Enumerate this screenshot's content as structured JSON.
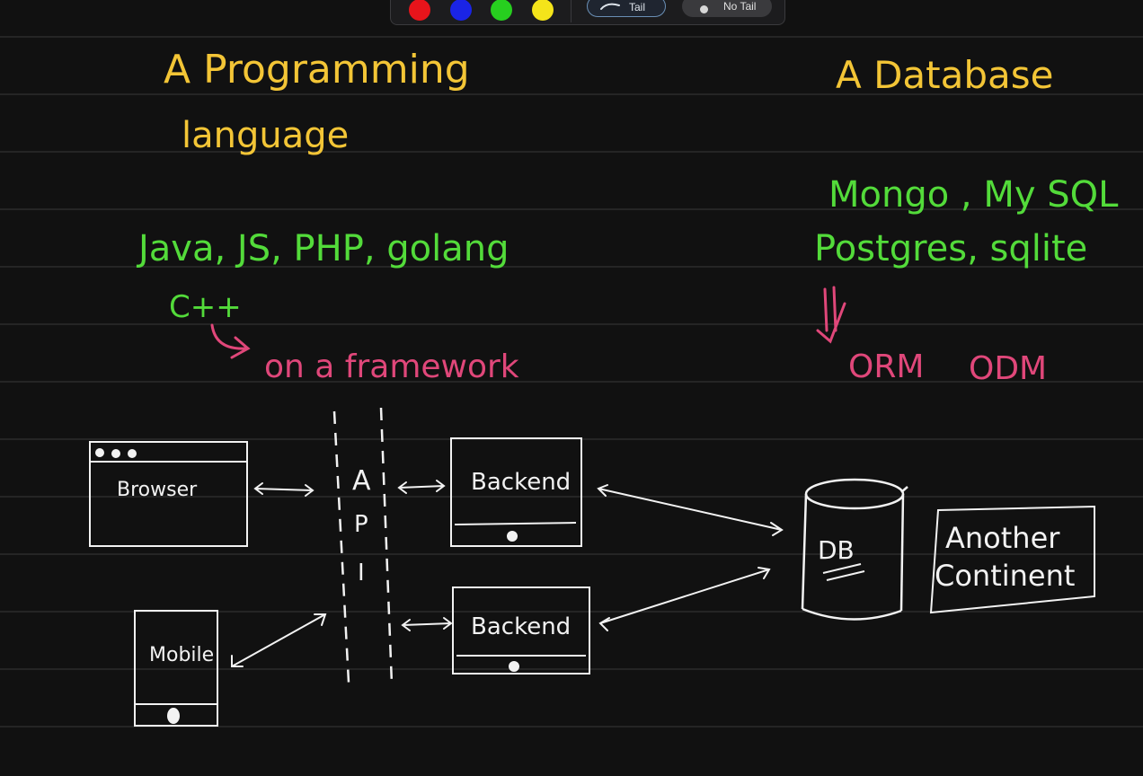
{
  "toolbar": {
    "colors": [
      "#e8141b",
      "#1a24e6",
      "#27cf1f",
      "#f4e41a"
    ],
    "tail_label": "Tail",
    "no_tail_label": "No Tail"
  },
  "notes": {
    "left_heading_line1": "A Programming",
    "left_heading_line2": "language",
    "right_heading": "A Database",
    "languages_line1": "Java, JS, PHP, golang",
    "languages_line2": "C++",
    "framework_note": "on a framework",
    "databases_line1": "Mongo , My SQL",
    "databases_line2": "Postgres, sqlite",
    "orm": "ORM",
    "odm": "ODM"
  },
  "diagram": {
    "browser": "Browser",
    "mobile": "Mobile",
    "api_letters": [
      "A",
      "P",
      "I"
    ],
    "backend_top": "Backend",
    "backend_bottom": "Backend",
    "db": "DB",
    "another_line1": "Another",
    "another_line2": "Continent"
  },
  "colors": {
    "background": "#111111",
    "yellow": "#f3c536",
    "green": "#53db3a",
    "pink": "#e0477a",
    "white": "#f2f2f2",
    "ruled_line": "#2c2c2c"
  }
}
